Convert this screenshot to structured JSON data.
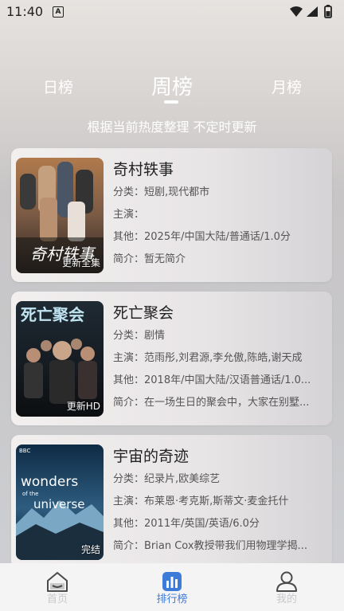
{
  "status": {
    "time": "11:40",
    "notification": "A"
  },
  "tabs": {
    "left": "日榜",
    "center": "周榜",
    "right": "月榜"
  },
  "subtitle": "根据当前热度整理 不定时更新",
  "items": [
    {
      "title": "奇村轶事",
      "category_label": "分类：",
      "category": "短剧,现代都市",
      "cast_label": "主演：",
      "cast": "",
      "other_label": "其他：",
      "other": "2025年/中国大陆/普通话/1.0分",
      "intro_label": "简介：",
      "intro": "暂无简介",
      "badge": "更新全集",
      "poster_text": "奇村轶事"
    },
    {
      "title": "死亡聚会",
      "category_label": "分类：",
      "category": "剧情",
      "cast_label": "主演：",
      "cast": "范雨彤,刘君源,李允傲,陈皓,谢天成",
      "other_label": "其他：",
      "other": "2018年/中国大陆/汉语普通话/1.0...",
      "intro_label": "简介：",
      "intro": "在一场生日的聚会中，大家在别墅...",
      "badge": "更新HD",
      "poster_text": "死亡聚会"
    },
    {
      "title": "宇宙的奇迹",
      "category_label": "分类：",
      "category": "纪录片,欧美综艺",
      "cast_label": "主演：",
      "cast": "布莱恩·考克斯,斯蒂文·麦金托什",
      "other_label": "其他：",
      "other": "2011年/英国/英语/6.0分",
      "intro_label": "简介：",
      "intro": "Brian Cox教授带我们用物理学揭...",
      "badge": "完结",
      "poster_text_1": "wonders",
      "poster_text_2": "of the",
      "poster_text_3": "universe",
      "poster_bbc": "BBC"
    }
  ],
  "nav": {
    "home": "首页",
    "rank": "排行榜",
    "me": "我的"
  },
  "colors": {
    "accent": "#3d7bd9",
    "inactive": "#c8c8cc",
    "text": "#222222"
  }
}
